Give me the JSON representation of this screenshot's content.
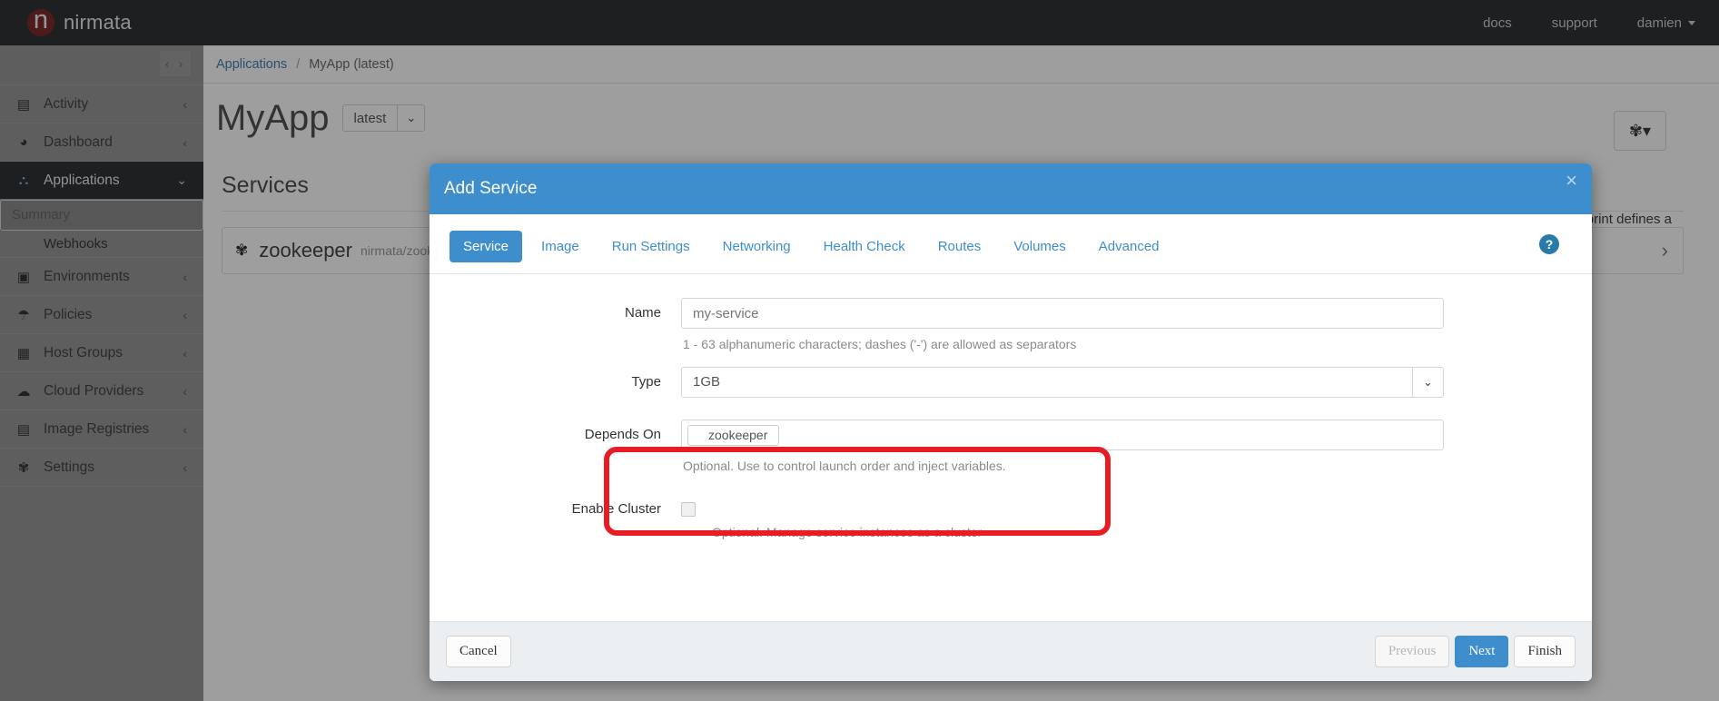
{
  "topbar": {
    "brand": "nirmata",
    "brand_logo_letter": "n",
    "nav": [
      {
        "label": "docs"
      },
      {
        "label": "support"
      },
      {
        "label": "damien",
        "has_caret": true
      }
    ]
  },
  "sidebar": {
    "collapse_toggle": "‹ ›",
    "items": [
      {
        "label": "Activity",
        "icon": "list-icon",
        "glyph": "▤",
        "chevron": "‹",
        "active": false
      },
      {
        "label": "Dashboard",
        "icon": "gauge-icon",
        "glyph": "◕",
        "chevron": "‹",
        "active": false
      },
      {
        "label": "Applications",
        "icon": "sitemap-icon",
        "glyph": "⛬",
        "chevron": "⌄",
        "active": true
      },
      {
        "label": "Environments",
        "icon": "image-icon",
        "glyph": "▣",
        "chevron": "‹",
        "active": false
      },
      {
        "label": "Policies",
        "icon": "umbrella-icon",
        "glyph": "☂",
        "chevron": "‹",
        "active": false
      },
      {
        "label": "Host Groups",
        "icon": "grid-icon",
        "glyph": "▦",
        "chevron": "‹",
        "active": false
      },
      {
        "label": "Cloud Providers",
        "icon": "cloud-icon",
        "glyph": "☁",
        "chevron": "‹",
        "active": false
      },
      {
        "label": "Image Registries",
        "icon": "database-icon",
        "glyph": "▤",
        "chevron": "‹",
        "active": false
      },
      {
        "label": "Settings",
        "icon": "gear-icon",
        "glyph": "✾",
        "chevron": "‹",
        "active": false
      }
    ],
    "sub_items": [
      {
        "label": "Summary",
        "selected": true
      },
      {
        "label": "Webhooks",
        "selected": false
      }
    ]
  },
  "main": {
    "breadcrumb": {
      "root": "Applications",
      "separator": "/",
      "current": "MyApp (latest)"
    },
    "app_title": "MyApp",
    "version_select": {
      "value": "latest",
      "caret": "⌄"
    },
    "gear_button": {
      "glyph": "✾",
      "caret": "▾"
    },
    "services_heading": "Services",
    "service_row": {
      "icon_glyph": "✾",
      "name": "zookeeper",
      "image": "nirmata/zook",
      "more_glyph": "›"
    },
    "blueprint_note": "his blueprint defines a",
    "icon_buttons": [
      {
        "name": "add-icon",
        "glyph": "＋"
      },
      {
        "name": "shuffle-icon",
        "glyph": "⤫"
      },
      {
        "name": "share-icon",
        "glyph": "⋖"
      },
      {
        "name": "folder-icon",
        "glyph": "▰"
      }
    ]
  },
  "modal": {
    "title": "Add Service",
    "close_glyph": "×",
    "help_glyph": "?",
    "tabs": [
      {
        "label": "Service",
        "active": true
      },
      {
        "label": "Image",
        "active": false
      },
      {
        "label": "Run Settings",
        "active": false
      },
      {
        "label": "Networking",
        "active": false
      },
      {
        "label": "Health Check",
        "active": false
      },
      {
        "label": "Routes",
        "active": false
      },
      {
        "label": "Volumes",
        "active": false
      },
      {
        "label": "Advanced",
        "active": false
      }
    ],
    "fields": {
      "name": {
        "label": "Name",
        "placeholder": "my-service",
        "value": "",
        "hint": "1 - 63 alphanumeric characters; dashes ('-') are allowed as separators"
      },
      "type": {
        "label": "Type",
        "value": "1GB",
        "caret": "⌄"
      },
      "depends_on": {
        "label": "Depends On",
        "tags": [
          "zookeeper"
        ],
        "hint": "Optional. Use to control launch order and inject variables."
      },
      "enable_cluster": {
        "label": "Enable Cluster",
        "checked": false,
        "hint": "Optional. Manage service instances as a cluster"
      }
    },
    "footer": {
      "cancel": "Cancel",
      "previous": "Previous",
      "next": "Next",
      "finish": "Finish"
    }
  },
  "annotation": {
    "highlight_color": "#e81c23",
    "target": "depends-on-field"
  }
}
